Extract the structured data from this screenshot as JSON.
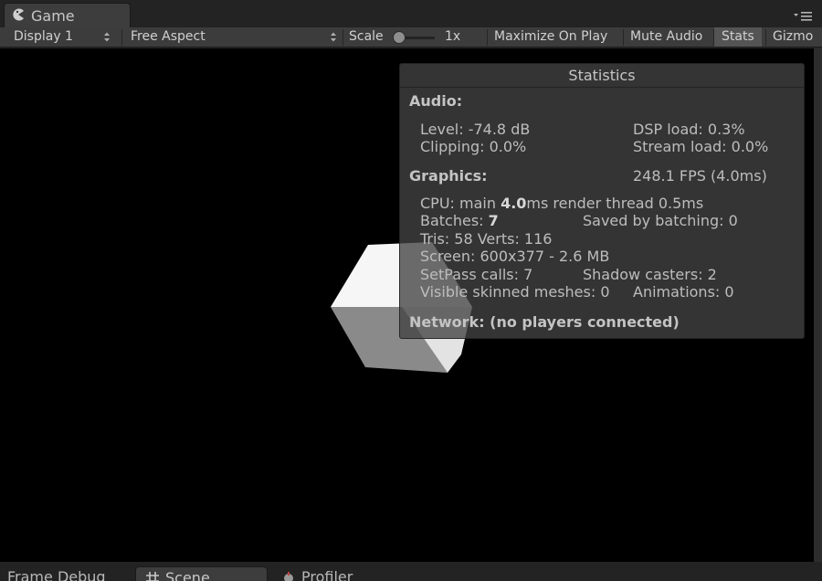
{
  "window": {
    "tab_label": "Game",
    "tab_icon": "pacman-icon",
    "panel_menu_icon": "panel-menu-icon"
  },
  "toolbar": {
    "display": "Display 1",
    "aspect": "Free Aspect",
    "scale_label": "Scale",
    "scale_value": "1x",
    "maximize_on_play": "Maximize On Play",
    "mute_audio": "Mute Audio",
    "stats": "Stats",
    "gizmos": "Gizmo",
    "stats_active": true
  },
  "stats": {
    "title": "Statistics",
    "audio_heading": "Audio:",
    "audio_level": "Level: -74.8 dB",
    "audio_dsp": "DSP load: 0.3%",
    "audio_clipping": "Clipping: 0.0%",
    "audio_stream": "Stream load: 0.0%",
    "graphics_heading": "Graphics:",
    "fps": "248.1 FPS (4.0ms)",
    "cpu_prefix": "CPU: main ",
    "cpu_main": "4.0",
    "cpu_suffix": "ms  render thread 0.5ms",
    "batches_label": "Batches: ",
    "batches_value": "7",
    "saved_batching": "Saved by batching: 0",
    "tris_verts": "Tris: 58   Verts: 116",
    "screen": "Screen: 600x377 - 2.6 MB",
    "setpass": "SetPass calls: 7",
    "shadow_casters": "Shadow casters: 2",
    "skinned": "Visible skinned meshes: 0",
    "animations": "Animations: 0",
    "network": "Network: (no players connected)"
  },
  "bottom_tabs": {
    "frame_debug": "Frame Debug",
    "scene": "Scene",
    "scene_icon": "grid-icon",
    "profiler": "Profiler",
    "profiler_icon": "profiler-icon"
  },
  "colors": {
    "viewport_bg": "#000000",
    "toolbar_bg": "#3c3c3c",
    "stats_active_bg": "#545454",
    "overlay_bg": "#424242"
  }
}
